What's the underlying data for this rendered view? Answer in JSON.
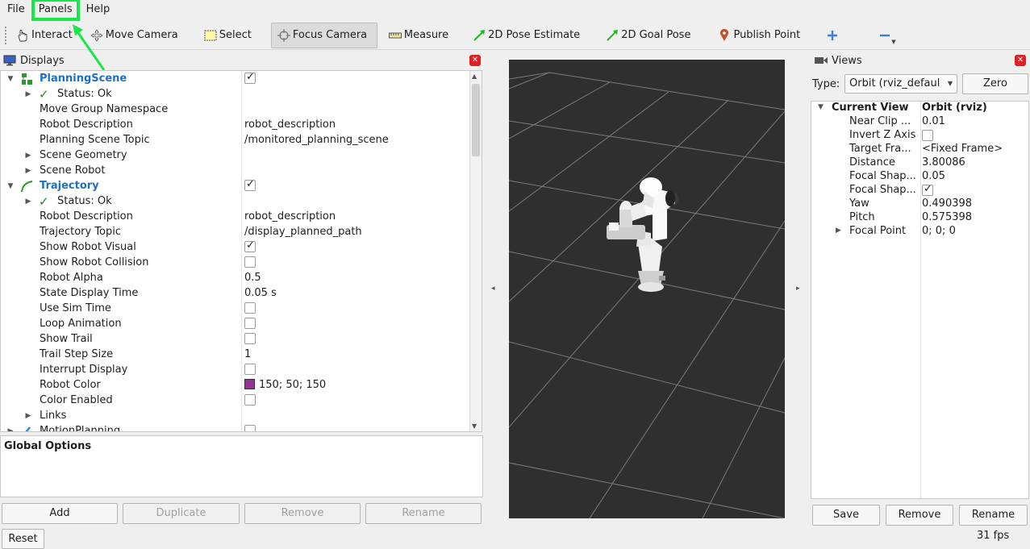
{
  "menu": {
    "file": "File",
    "panels": "Panels",
    "help": "Help"
  },
  "toolbar": {
    "interact": "Interact",
    "move_camera": "Move Camera",
    "select": "Select",
    "focus_camera": "Focus Camera",
    "measure": "Measure",
    "pose_estimate": "2D Pose Estimate",
    "goal_pose": "2D Goal Pose",
    "publish_point": "Publish Point"
  },
  "displays": {
    "title": "Displays",
    "rows": [
      {
        "name": "PlanningScene",
        "value": "",
        "indent": 0,
        "arrow": "open",
        "bold": true,
        "checkbox": "checked"
      },
      {
        "name": "Status: Ok",
        "value": "",
        "indent": 1,
        "arrow": "closed",
        "status": true
      },
      {
        "name": "Move Group Namespace",
        "value": "",
        "indent": 1
      },
      {
        "name": "Robot Description",
        "value": "robot_description",
        "indent": 1
      },
      {
        "name": "Planning Scene Topic",
        "value": "/monitored_planning_scene",
        "indent": 1
      },
      {
        "name": "Scene Geometry",
        "value": "",
        "indent": 1,
        "arrow": "closed"
      },
      {
        "name": "Scene Robot",
        "value": "",
        "indent": 1,
        "arrow": "closed"
      },
      {
        "name": "Trajectory",
        "value": "",
        "indent": 0,
        "arrow": "open",
        "bold": true,
        "checkbox": "checked"
      },
      {
        "name": "Status: Ok",
        "value": "",
        "indent": 1,
        "arrow": "closed",
        "status": true
      },
      {
        "name": "Robot Description",
        "value": "robot_description",
        "indent": 1
      },
      {
        "name": "Trajectory Topic",
        "value": "/display_planned_path",
        "indent": 1
      },
      {
        "name": "Show Robot Visual",
        "value": "",
        "indent": 1,
        "checkbox": "checked"
      },
      {
        "name": "Show Robot Collision",
        "value": "",
        "indent": 1,
        "checkbox": "unchecked"
      },
      {
        "name": "Robot Alpha",
        "value": "0.5",
        "indent": 1
      },
      {
        "name": "State Display Time",
        "value": "0.05 s",
        "indent": 1
      },
      {
        "name": "Use Sim Time",
        "value": "",
        "indent": 1,
        "checkbox": "unchecked"
      },
      {
        "name": "Loop Animation",
        "value": "",
        "indent": 1,
        "checkbox": "unchecked"
      },
      {
        "name": "Show Trail",
        "value": "",
        "indent": 1,
        "checkbox": "unchecked"
      },
      {
        "name": "Trail Step Size",
        "value": "1",
        "indent": 1
      },
      {
        "name": "Interrupt Display",
        "value": "",
        "indent": 1,
        "checkbox": "unchecked"
      },
      {
        "name": "Robot Color",
        "value": "150; 50; 150",
        "indent": 1,
        "swatch": "#963296"
      },
      {
        "name": "Color Enabled",
        "value": "",
        "indent": 1,
        "checkbox": "unchecked"
      },
      {
        "name": "Links",
        "value": "",
        "indent": 1,
        "arrow": "closed"
      },
      {
        "name": "MotionPlanning",
        "value": "",
        "indent": 0,
        "arrow": "closed",
        "checkbox": "unchecked"
      }
    ],
    "global_options": "Global Options",
    "buttons": {
      "add": "Add",
      "duplicate": "Duplicate",
      "remove": "Remove",
      "rename": "Rename"
    },
    "reset": "Reset"
  },
  "views": {
    "title": "Views",
    "type_label": "Type:",
    "type_value": "Orbit (rviz_defaul",
    "zero": "Zero",
    "header_name": "Current View",
    "header_value": "Orbit (rviz)",
    "rows": [
      {
        "name": "Near Clip ...",
        "value": "0.01"
      },
      {
        "name": "Invert Z Axis",
        "value": "",
        "checkbox": "unchecked"
      },
      {
        "name": "Target Fra...",
        "value": "<Fixed Frame>"
      },
      {
        "name": "Distance",
        "value": "3.80086"
      },
      {
        "name": "Focal Shap...",
        "value": "0.05"
      },
      {
        "name": "Focal Shap...",
        "value": "",
        "checkbox": "checked"
      },
      {
        "name": "Yaw",
        "value": "0.490398"
      },
      {
        "name": "Pitch",
        "value": "0.575398"
      },
      {
        "name": "Focal Point",
        "value": "0; 0; 0",
        "arrow": "closed"
      }
    ],
    "buttons": {
      "save": "Save",
      "remove": "Remove",
      "rename": "Rename"
    }
  },
  "status": {
    "fps": "31 fps"
  },
  "colors": {
    "highlight": "#17e84a",
    "link_blue": "#1f6fc4",
    "viewport_bg": "#2f2f2f",
    "close_red": "#e02020"
  }
}
